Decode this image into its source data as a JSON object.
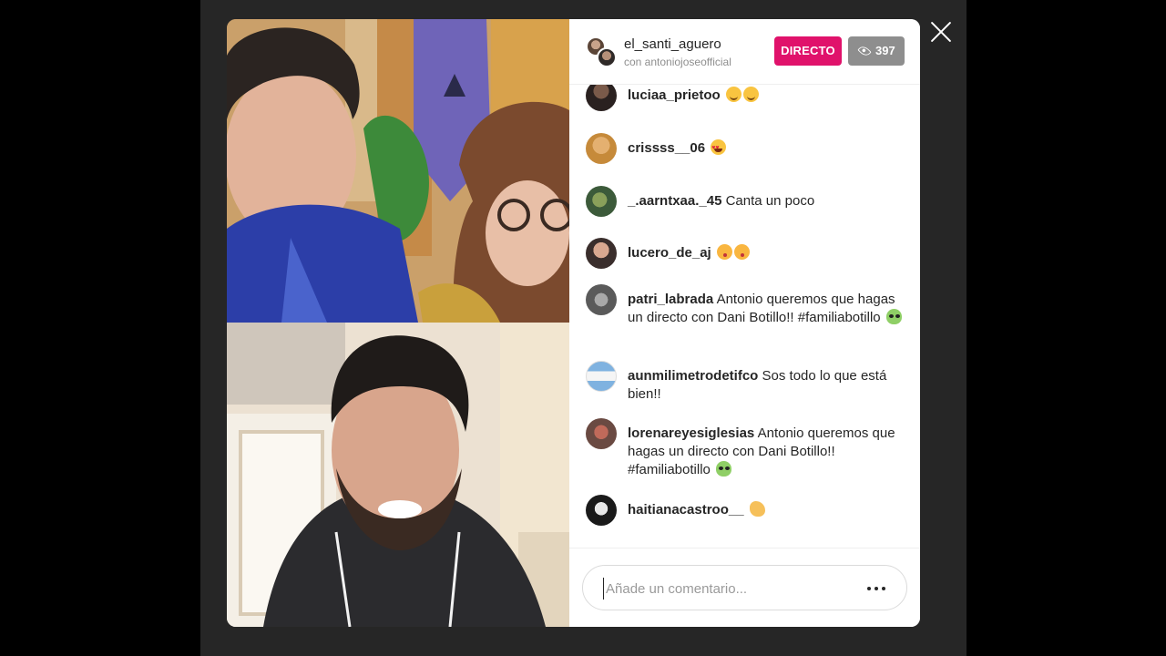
{
  "stream": {
    "host_username": "el_santi_aguero",
    "with_text": "con antoniojoseofficial",
    "live_label": "DIRECTO",
    "viewer_count": "397"
  },
  "comments": [
    {
      "user": "luciaa_prietoo",
      "text": "",
      "emojis": [
        "smile",
        "smile"
      ]
    },
    {
      "user": "crissss__06",
      "text": "",
      "emojis": [
        "hearteyes"
      ]
    },
    {
      "user": "_.aarntxaa._45",
      "text": "Canta un poco",
      "emojis": []
    },
    {
      "user": "lucero_de_aj",
      "text": "",
      "emojis": [
        "kiss",
        "kiss"
      ]
    },
    {
      "user": "patri_labrada",
      "text": "Antonio queremos que hagas un directo con Dani Botillo!! #familiabotillo",
      "emojis": [
        "alien"
      ]
    },
    {
      "user": "aunmilimetrodetifco",
      "text": "Sos todo lo que está bien!!",
      "emojis": []
    },
    {
      "user": "lorenareyesiglesias",
      "text": "Antonio queremos que hagas un directo con Dani Botillo!! #familiabotillo",
      "emojis": [
        "alien"
      ]
    },
    {
      "user": "haitianacastroo__",
      "text": "",
      "emojis": [
        "clap"
      ]
    }
  ],
  "composer": {
    "placeholder": "Añade un comentario..."
  },
  "colors": {
    "live_badge": "#e0126b",
    "viewer_badge": "#8e8e8e",
    "backdrop": "#262626"
  },
  "icons": [
    "close-icon",
    "eye-icon",
    "more-options-icon"
  ]
}
